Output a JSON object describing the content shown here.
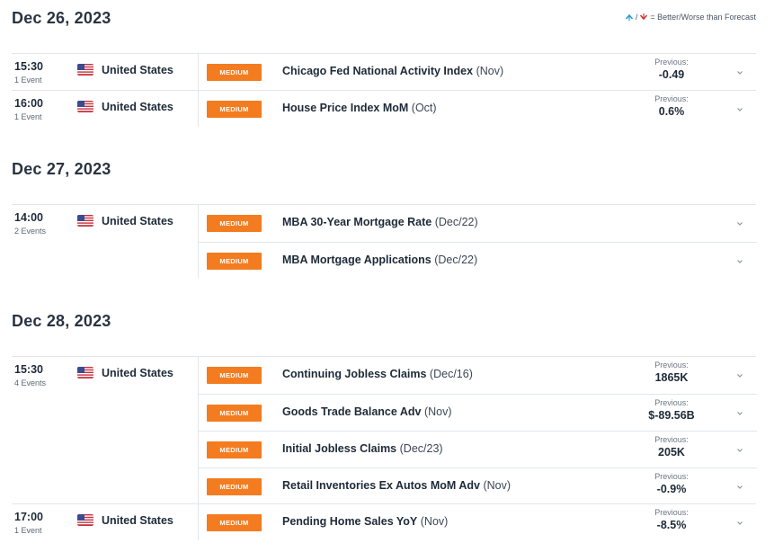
{
  "legend": {
    "text": "= Better/Worse than Forecast",
    "icons": [
      "arrow-up-better-icon",
      "arrow-down-worse-icon"
    ]
  },
  "days": [
    {
      "title": "Dec 26, 2023",
      "groups": [
        {
          "time": "15:30",
          "events": "1 Event",
          "country": "United States",
          "items": [
            {
              "impact": "MEDIUM",
              "name": "Chicago Fed National Activity Index",
              "period": "(Nov)",
              "prev_label": "Previous:",
              "prev_value": "-0.49"
            }
          ]
        },
        {
          "time": "16:00",
          "events": "1 Event",
          "country": "United States",
          "items": [
            {
              "impact": "MEDIUM",
              "name": "House Price Index MoM",
              "period": "(Oct)",
              "prev_label": "Previous:",
              "prev_value": "0.6%"
            }
          ]
        }
      ]
    },
    {
      "title": "Dec 27, 2023",
      "groups": [
        {
          "time": "14:00",
          "events": "2 Events",
          "country": "United States",
          "items": [
            {
              "impact": "MEDIUM",
              "name": "MBA 30-Year Mortgage Rate",
              "period": "(Dec/22)",
              "prev_label": "",
              "prev_value": ""
            },
            {
              "impact": "MEDIUM",
              "name": "MBA Mortgage Applications",
              "period": "(Dec/22)",
              "prev_label": "",
              "prev_value": ""
            }
          ]
        }
      ]
    },
    {
      "title": "Dec 28, 2023",
      "groups": [
        {
          "time": "15:30",
          "events": "4 Events",
          "country": "United States",
          "items": [
            {
              "impact": "MEDIUM",
              "name": "Continuing Jobless Claims",
              "period": "(Dec/16)",
              "prev_label": "Previous:",
              "prev_value": "1865K"
            },
            {
              "impact": "MEDIUM",
              "name": "Goods Trade Balance Adv",
              "period": "(Nov)",
              "prev_label": "Previous:",
              "prev_value": "$-89.56B"
            },
            {
              "impact": "MEDIUM",
              "name": "Initial Jobless Claims",
              "period": "(Dec/23)",
              "prev_label": "Previous:",
              "prev_value": "205K"
            },
            {
              "impact": "MEDIUM",
              "name": "Retail Inventories Ex Autos MoM Adv",
              "period": "(Nov)",
              "prev_label": "Previous:",
              "prev_value": "-0.9%"
            }
          ]
        },
        {
          "time": "17:00",
          "events": "1 Event",
          "country": "United States",
          "items": [
            {
              "impact": "MEDIUM",
              "name": "Pending Home Sales YoY",
              "period": "(Nov)",
              "prev_label": "Previous:",
              "prev_value": "-8.5%"
            }
          ]
        }
      ]
    }
  ],
  "colors": {
    "impact_medium": "#f47c20",
    "divider": "#e2e6ea",
    "better": "#2a9dcf",
    "worse": "#d9342b"
  }
}
